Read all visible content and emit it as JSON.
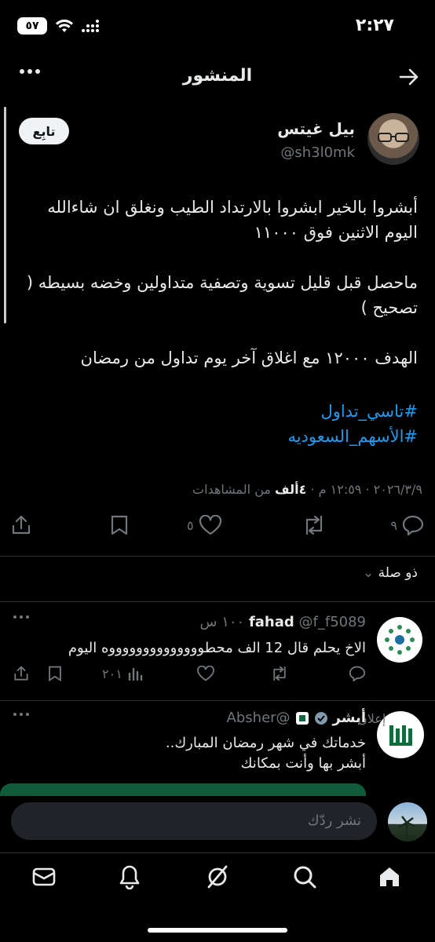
{
  "status": {
    "time": "٢:٢٧",
    "battery": "٥٧"
  },
  "header": {
    "title": "المنشور"
  },
  "post": {
    "author_name": "بيل غيتس",
    "author_handle": "@sh3l0mk",
    "follow_label": "تابِع",
    "paragraphs": [
      "أبشروا بالخير ابشروا بالارتداد الطيب ونغلق ان شاءالله اليوم الاثنين فوق ١١٠٠٠",
      "ماحصل قبل قليل تسوية وتصفية متداولين وخضه بسيطه ( تصحيح )",
      "الهدف ١٢٠٠٠  مع اغلاق آخر يوم تداول من رمضان"
    ],
    "hashtags": [
      "#تاسي_تداول",
      "#الأسهم_السعوديه"
    ],
    "time": "١٢:٥٩ م",
    "date": "٢٠٢٦/٣/٩",
    "views_count": "٤ألف",
    "views_label": "من المشاهدات",
    "replies": "٩",
    "likes": "٥"
  },
  "relevance_label": "ذو صلة",
  "reply": {
    "name": "fahad",
    "handle": "@f_f5089",
    "time": "١٠٠ س",
    "text": "الاخ يحلم قال 12 الف محطووووووووووووووه اليوم",
    "views": "٢٠١"
  },
  "ad": {
    "name": "أبشر",
    "handle": "@Absher",
    "label": "إعلان",
    "line1": "خدماتك في شهر رمضان المبارك..",
    "line2": "أبشر بها وأنت بمكانك"
  },
  "composer": {
    "placeholder": "نشر ردّك"
  },
  "colors": {
    "accent": "#1d9bf0",
    "muted": "#71767b",
    "ad_green": "#0f5b3a"
  }
}
